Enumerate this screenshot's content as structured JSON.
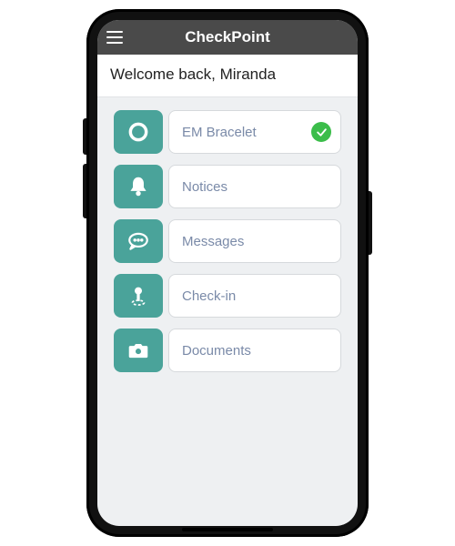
{
  "header": {
    "title": "CheckPoint"
  },
  "welcome_text": "Welcome  back,  Miranda",
  "colors": {
    "accent": "#4aa39a",
    "success": "#3bbd4a"
  },
  "menu": [
    {
      "icon": "circle-icon",
      "label": "EM  Bracelet",
      "status": "ok"
    },
    {
      "icon": "bell-icon",
      "label": "Notices"
    },
    {
      "icon": "chat-icon",
      "label": "Messages"
    },
    {
      "icon": "pin-icon",
      "label": "Check-in"
    },
    {
      "icon": "camera-icon",
      "label": "Documents"
    }
  ]
}
